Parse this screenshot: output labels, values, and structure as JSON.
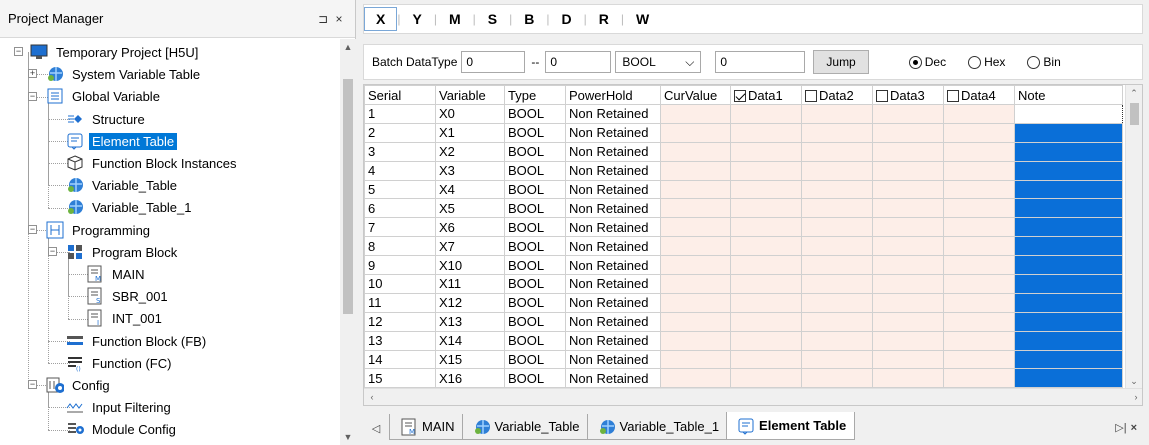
{
  "project_manager": {
    "title": "Project Manager",
    "pin_glyph": "⊐",
    "close_glyph": "×",
    "tree": [
      {
        "label": "Temporary Project [H5U]",
        "icon": "monitor-icon",
        "level": 0,
        "expander": "-"
      },
      {
        "label": "System Variable Table",
        "icon": "variable-globe-icon",
        "level": 1,
        "expander": "+"
      },
      {
        "label": "Global Variable",
        "icon": "global-variable-icon",
        "level": 1,
        "expander": "-"
      },
      {
        "label": "Structure",
        "icon": "structure-icon",
        "level": 2
      },
      {
        "label": "Element Table",
        "icon": "element-table-icon",
        "level": 2,
        "selected": true
      },
      {
        "label": "Function Block Instances",
        "icon": "cube-icon",
        "level": 2
      },
      {
        "label": "Variable_Table",
        "icon": "variable-globe-icon",
        "level": 2
      },
      {
        "label": "Variable_Table_1",
        "icon": "variable-globe-icon",
        "level": 2
      },
      {
        "label": "Programming",
        "icon": "ladder-icon",
        "level": 1,
        "expander": "-"
      },
      {
        "label": "Program Block",
        "icon": "program-block-icon",
        "level": 2,
        "expander": "-"
      },
      {
        "label": "MAIN",
        "icon": "main-program-icon",
        "level": 3
      },
      {
        "label": "SBR_001",
        "icon": "subroutine-icon",
        "level": 3
      },
      {
        "label": "INT_001",
        "icon": "interrupt-icon",
        "level": 3
      },
      {
        "label": "Function Block (FB)",
        "icon": "function-block-icon",
        "level": 2
      },
      {
        "label": "Function (FC)",
        "icon": "function-icon",
        "level": 2
      },
      {
        "label": "Config",
        "icon": "config-icon",
        "level": 1,
        "expander": "-"
      },
      {
        "label": "Input Filtering",
        "icon": "input-filter-icon",
        "level": 2
      },
      {
        "label": "Module Config",
        "icon": "module-config-icon",
        "level": 2
      }
    ]
  },
  "register_tabs": [
    "X",
    "Y",
    "M",
    "S",
    "B",
    "D",
    "R",
    "W"
  ],
  "toolbar": {
    "batch_label": "Batch DataType",
    "from_value": "0",
    "range_sep": "--",
    "to_value": "0",
    "datatype_value": "BOOL",
    "batch_value": "0",
    "jump_label": "Jump",
    "radios": [
      {
        "label": "Dec",
        "checked": true
      },
      {
        "label": "Hex",
        "checked": false
      },
      {
        "label": "Bin",
        "checked": false
      }
    ]
  },
  "table": {
    "headers": [
      "Serial",
      "Variable",
      "Type",
      "PowerHold",
      "CurValue",
      "Data1",
      "Data2",
      "Data3",
      "Data4",
      "Note"
    ],
    "header_checkboxes": {
      "Data1": true,
      "Data2": false,
      "Data3": false,
      "Data4": false
    },
    "rows": [
      [
        "1",
        "X0",
        "BOOL",
        "Non Retained"
      ],
      [
        "2",
        "X1",
        "BOOL",
        "Non Retained"
      ],
      [
        "3",
        "X2",
        "BOOL",
        "Non Retained"
      ],
      [
        "4",
        "X3",
        "BOOL",
        "Non Retained"
      ],
      [
        "5",
        "X4",
        "BOOL",
        "Non Retained"
      ],
      [
        "6",
        "X5",
        "BOOL",
        "Non Retained"
      ],
      [
        "7",
        "X6",
        "BOOL",
        "Non Retained"
      ],
      [
        "8",
        "X7",
        "BOOL",
        "Non Retained"
      ],
      [
        "9",
        "X10",
        "BOOL",
        "Non Retained"
      ],
      [
        "10",
        "X11",
        "BOOL",
        "Non Retained"
      ],
      [
        "11",
        "X12",
        "BOOL",
        "Non Retained"
      ],
      [
        "12",
        "X13",
        "BOOL",
        "Non Retained"
      ],
      [
        "13",
        "X14",
        "BOOL",
        "Non Retained"
      ],
      [
        "14",
        "X15",
        "BOOL",
        "Non Retained"
      ],
      [
        "15",
        "X16",
        "BOOL",
        "Non Retained"
      ]
    ]
  },
  "doc_tabs": [
    {
      "label": "MAIN",
      "icon": "main-program-icon",
      "active": false
    },
    {
      "label": "Variable_Table",
      "icon": "variable-globe-icon",
      "active": false
    },
    {
      "label": "Variable_Table_1",
      "icon": "variable-globe-icon",
      "active": false
    },
    {
      "label": "Element Table",
      "icon": "element-table-icon",
      "active": true
    }
  ],
  "colors": {
    "selection": "#0078d7",
    "note_fill": "#0a6fd8",
    "value_cell": "#fdeee8"
  }
}
